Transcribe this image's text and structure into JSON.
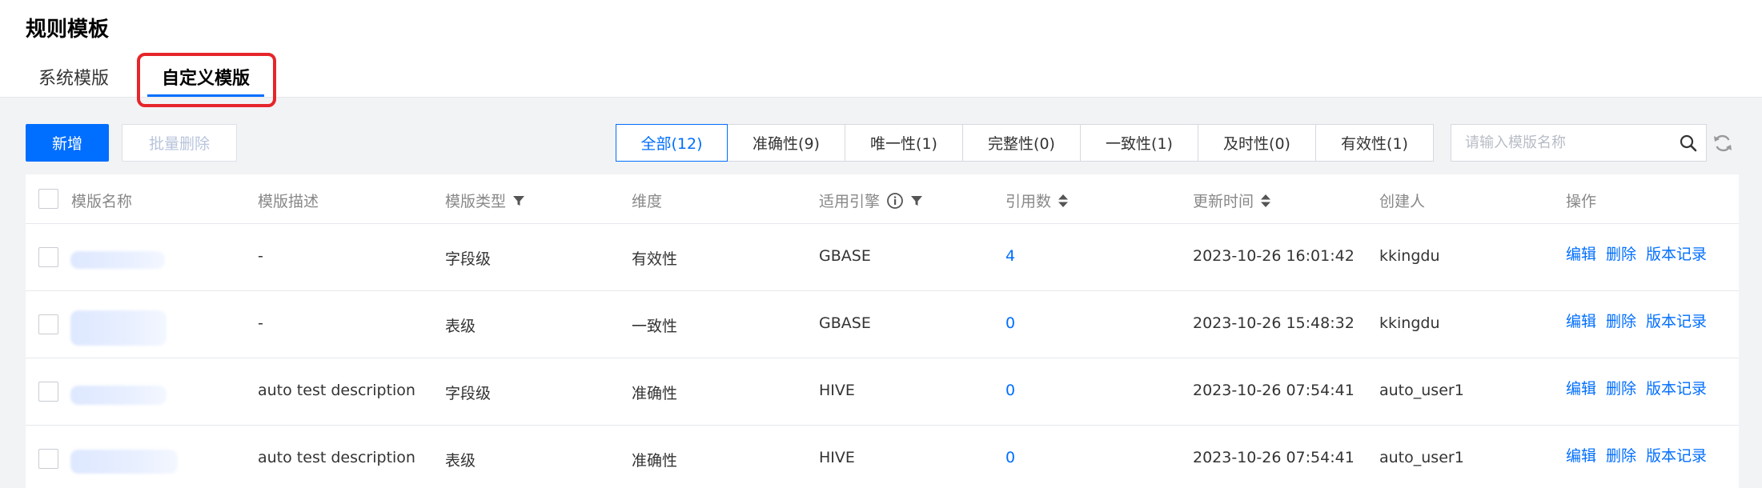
{
  "page": {
    "title": "规则模板"
  },
  "tabs": {
    "system": "系统模版",
    "custom": "自定义模版"
  },
  "toolbar": {
    "add_label": "新增",
    "batch_delete_label": "批量删除"
  },
  "filters": [
    {
      "label": "全部(12)",
      "active": true
    },
    {
      "label": "准确性(9)",
      "active": false
    },
    {
      "label": "唯一性(1)",
      "active": false
    },
    {
      "label": "完整性(0)",
      "active": false
    },
    {
      "label": "一致性(1)",
      "active": false
    },
    {
      "label": "及时性(0)",
      "active": false
    },
    {
      "label": "有效性(1)",
      "active": false
    }
  ],
  "search": {
    "placeholder": "请输入模版名称",
    "value": ""
  },
  "table": {
    "columns": [
      "模版名称",
      "模版描述",
      "模版类型",
      "维度",
      "适用引擎",
      "引用数",
      "更新时间",
      "创建人",
      "操作"
    ],
    "row_actions": {
      "edit": "编辑",
      "delete": "删除",
      "history": "版本记录"
    },
    "rows": [
      {
        "name": "",
        "description": "-",
        "type": "字段级",
        "dimension": "有效性",
        "engine": "GBASE",
        "refs": "4",
        "updated": "2023-10-26 16:01:42",
        "creator": "kkingdu"
      },
      {
        "name": "",
        "description": "-",
        "type": "表级",
        "dimension": "一致性",
        "engine": "GBASE",
        "refs": "0",
        "updated": "2023-10-26 15:48:32",
        "creator": "kkingdu"
      },
      {
        "name": "",
        "description": "auto test description",
        "type": "字段级",
        "dimension": "准确性",
        "engine": "HIVE",
        "refs": "0",
        "updated": "2023-10-26 07:54:41",
        "creator": "auto_user1"
      },
      {
        "name": "",
        "description": "auto test description",
        "type": "表级",
        "dimension": "准确性",
        "engine": "HIVE",
        "refs": "0",
        "updated": "2023-10-26 07:54:41",
        "creator": "auto_user1"
      }
    ]
  },
  "colors": {
    "accent": "#006eff",
    "highlight": "#e5262a"
  },
  "icons": {
    "search": "search-icon",
    "refresh": "refresh-icon",
    "filter": "filter-icon",
    "info": "info-icon",
    "sort": "sort-icon"
  }
}
